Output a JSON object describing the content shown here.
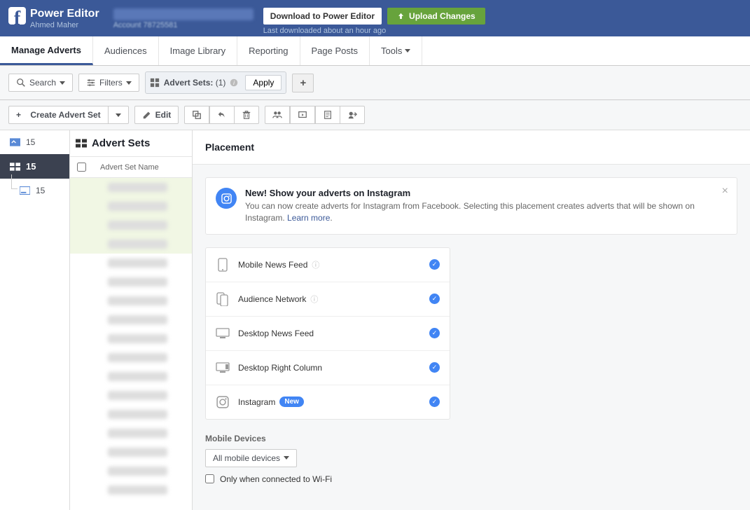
{
  "header": {
    "app_title": "Power Editor",
    "user_name": "Ahmed Maher",
    "account_label": "Account 78725581",
    "download_btn": "Download to Power Editor",
    "upload_btn": "Upload Changes",
    "last_download": "Last downloaded about an hour ago"
  },
  "nav_tabs": [
    "Manage Adverts",
    "Audiences",
    "Image Library",
    "Reporting",
    "Page Posts",
    "Tools"
  ],
  "filter_bar": {
    "search": "Search",
    "filters": "Filters",
    "chip_label": "Advert Sets:",
    "chip_count": "(1)",
    "apply": "Apply"
  },
  "toolbar": {
    "create": "Create Advert Set",
    "edit": "Edit"
  },
  "left_nav": {
    "campaigns_count": "15",
    "adsets_count": "15",
    "ads_count": "15"
  },
  "mid": {
    "title": "Advert Sets",
    "col_name": "Advert Set Name"
  },
  "panel": {
    "title": "Placement",
    "notice_title": "New! Show your adverts on Instagram",
    "notice_text": "You can now create adverts for Instagram from Facebook. Selecting this placement creates adverts that will be shown on Instagram. ",
    "notice_learn": "Learn more",
    "placements": [
      {
        "label": "Mobile News Feed",
        "info": true
      },
      {
        "label": "Audience Network",
        "info": true
      },
      {
        "label": "Desktop News Feed",
        "info": false
      },
      {
        "label": "Desktop Right Column",
        "info": false
      },
      {
        "label": "Instagram",
        "new": true
      }
    ],
    "new_label": "New",
    "mobile_devices_title": "Mobile Devices",
    "mobile_devices_value": "All mobile devices",
    "wifi_label": "Only when connected to Wi-Fi"
  }
}
